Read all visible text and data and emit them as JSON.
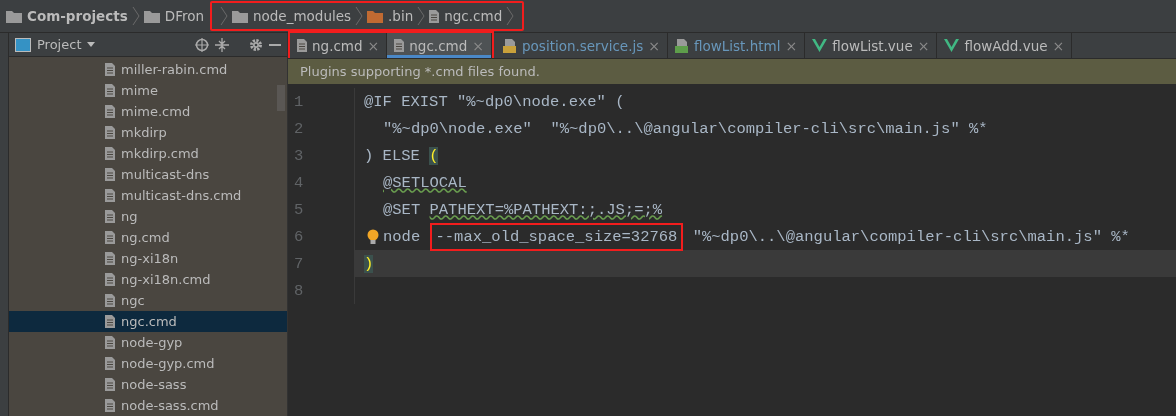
{
  "breadcrumb": [
    {
      "label": "Com-projects",
      "kind": "folder",
      "bold": true,
      "highlighted": false
    },
    {
      "label": "DFron",
      "kind": "folder",
      "bold": false,
      "highlighted": false
    },
    {
      "label": "node_modules",
      "kind": "folder",
      "bold": false,
      "highlighted": true
    },
    {
      "label": ".bin",
      "kind": "excluded-folder",
      "bold": false,
      "highlighted": true
    },
    {
      "label": "ngc.cmd",
      "kind": "file",
      "bold": false,
      "highlighted": true
    }
  ],
  "project_panel": {
    "title": "Project",
    "items": [
      {
        "label": "miller-rabin.cmd",
        "selected": false
      },
      {
        "label": "mime",
        "selected": false
      },
      {
        "label": "mime.cmd",
        "selected": false
      },
      {
        "label": "mkdirp",
        "selected": false
      },
      {
        "label": "mkdirp.cmd",
        "selected": false
      },
      {
        "label": "multicast-dns",
        "selected": false
      },
      {
        "label": "multicast-dns.cmd",
        "selected": false
      },
      {
        "label": "ng",
        "selected": false
      },
      {
        "label": "ng.cmd",
        "selected": false
      },
      {
        "label": "ng-xi18n",
        "selected": false
      },
      {
        "label": "ng-xi18n.cmd",
        "selected": false
      },
      {
        "label": "ngc",
        "selected": false
      },
      {
        "label": "ngc.cmd",
        "selected": true
      },
      {
        "label": "node-gyp",
        "selected": false
      },
      {
        "label": "node-gyp.cmd",
        "selected": false
      },
      {
        "label": "node-sass",
        "selected": false
      },
      {
        "label": "node-sass.cmd",
        "selected": false
      }
    ]
  },
  "tabs": [
    {
      "label": "ng.cmd",
      "kind": "file",
      "close": "×",
      "selected": false,
      "highlighted": true
    },
    {
      "label": "ngc.cmd",
      "kind": "file",
      "close": "×",
      "selected": true,
      "highlighted": true
    },
    {
      "label": "position.service.js",
      "kind": "js",
      "close": "×",
      "selected": false,
      "highlighted": false
    },
    {
      "label": "flowList.html",
      "kind": "html",
      "close": "×",
      "selected": false,
      "highlighted": false
    },
    {
      "label": "flowList.vue",
      "kind": "vue",
      "close": "×",
      "selected": false,
      "highlighted": false
    },
    {
      "label": "flowAdd.vue",
      "kind": "vue",
      "close": "×",
      "selected": false,
      "highlighted": false
    }
  ],
  "banner": "Plugins supporting *.cmd files found.",
  "code_lines": [
    {
      "number": "1",
      "indent": false,
      "lightbulb": false,
      "current": false,
      "segments": [
        {
          "text": "@IF EXIST \"%~dp0\\node.exe\" (",
          "kind": "plain"
        }
      ]
    },
    {
      "number": "2",
      "indent": true,
      "lightbulb": false,
      "current": false,
      "segments": [
        {
          "text": "\"%~dp0\\node.exe\"  \"%~dp0\\..\\@angular\\compiler-cli\\src\\main.js\" %*",
          "kind": "plain"
        }
      ]
    },
    {
      "number": "3",
      "indent": false,
      "lightbulb": false,
      "current": false,
      "segments": [
        {
          "text": ") ELSE ",
          "kind": "plain"
        },
        {
          "text": "(",
          "kind": "bracket"
        }
      ]
    },
    {
      "number": "4",
      "indent": true,
      "lightbulb": false,
      "current": false,
      "segments": [
        {
          "text": "@SETLOCAL",
          "kind": "squiggle"
        }
      ]
    },
    {
      "number": "5",
      "indent": true,
      "lightbulb": false,
      "current": false,
      "segments": [
        {
          "text": "@SET ",
          "kind": "plain"
        },
        {
          "text": "PATHEXT=%PATHEXT:;.JS;=;%",
          "kind": "squiggle"
        }
      ]
    },
    {
      "number": "6",
      "indent": true,
      "lightbulb": true,
      "current": false,
      "segments": [
        {
          "text": "node ",
          "kind": "plain"
        },
        {
          "text": "--max_old_space_size=32768",
          "kind": "boxed"
        },
        {
          "text": " \"%~dp0\\..\\@angular\\compiler-cli\\src\\main.js\" %*",
          "kind": "plain"
        }
      ]
    },
    {
      "number": "7",
      "indent": false,
      "lightbulb": false,
      "current": true,
      "segments": [
        {
          "text": ")",
          "kind": "bracket"
        }
      ]
    },
    {
      "number": "8",
      "lightbulb": false,
      "current": false
    }
  ]
}
